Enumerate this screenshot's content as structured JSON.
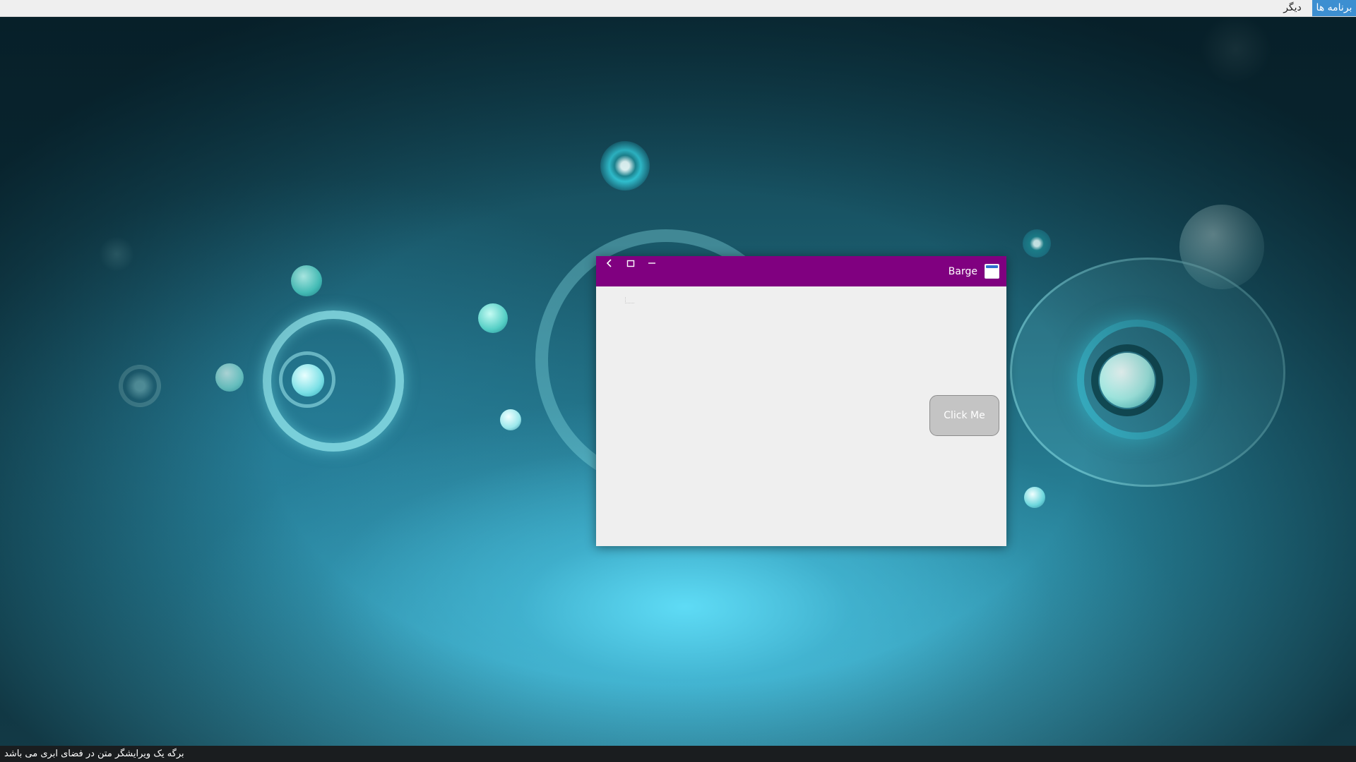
{
  "top_panel": {
    "apps_menu_label": "برنامه ها",
    "other_menu_label": "دیگر",
    "accent_color": "#3d8fd1"
  },
  "window": {
    "title": "Barge",
    "titlebar_color": "#800080",
    "titlebar_icons": [
      "back-arrow-icon",
      "maximize-icon",
      "minimize-icon"
    ],
    "app_icon": "window-app-icon",
    "content": {
      "button_label": "Click Me"
    }
  },
  "status_bar": {
    "text": "برگه یک ویرایشگر متن در فضای ابری می باشد"
  }
}
